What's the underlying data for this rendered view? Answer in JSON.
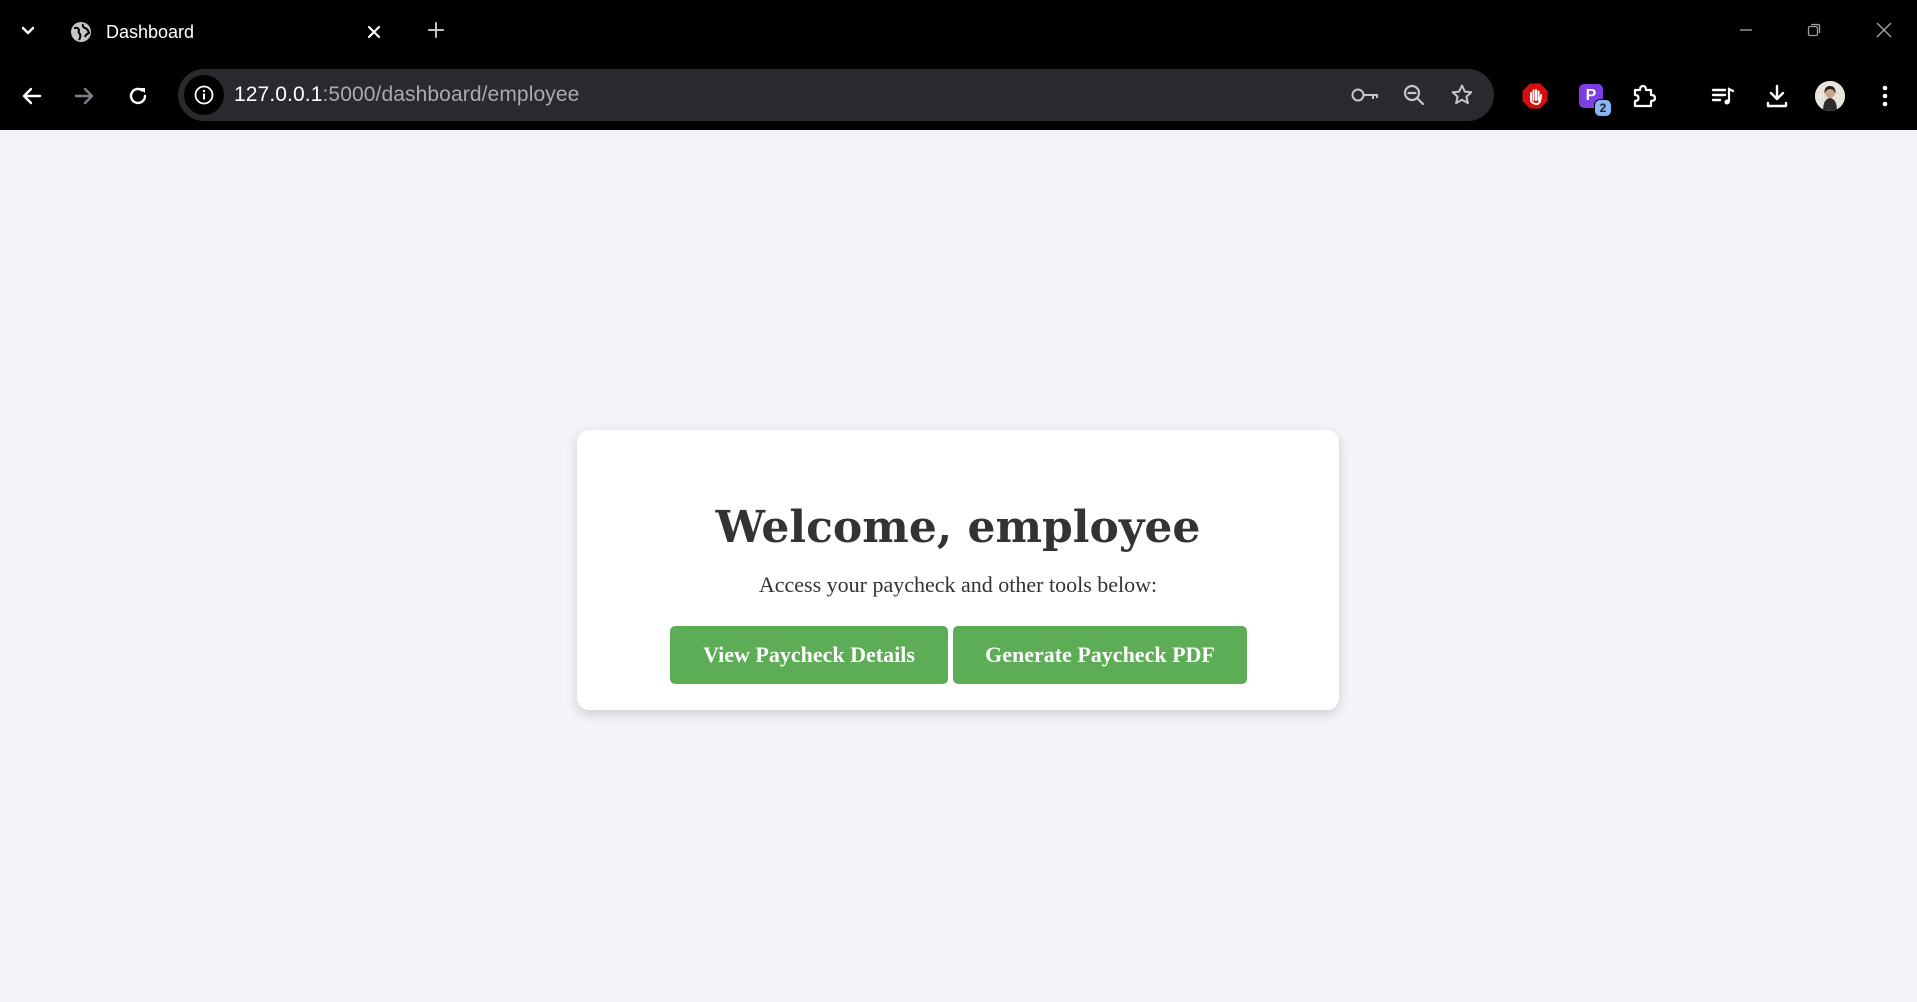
{
  "browser": {
    "tab": {
      "title": "Dashboard",
      "favicon": "globe-icon"
    },
    "address_bar": {
      "host": "127.0.0.1",
      "path": ":5000/dashboard/employee"
    },
    "extensions": {
      "p_extension_label": "P",
      "p_extension_badge": "2"
    },
    "icons": [
      "tab-list-icon",
      "globe-icon",
      "close-icon",
      "plus-icon",
      "minimize-icon",
      "restore-icon",
      "window-close-icon",
      "back-icon",
      "forward-icon",
      "reload-icon",
      "info-icon",
      "key-icon",
      "zoom-out-icon",
      "star-icon",
      "stop-hand-icon",
      "puzzle-icon",
      "media-queue-icon",
      "download-icon",
      "avatar",
      "menu-icon"
    ]
  },
  "page": {
    "background": "#f4f4f8",
    "card": {
      "heading": "Welcome, employee",
      "subtitle": "Access your paycheck and other tools below:",
      "buttons": {
        "view_paycheck": "View Paycheck Details",
        "generate_pdf": "Generate Paycheck PDF"
      },
      "button_color": "#5cad55"
    }
  }
}
